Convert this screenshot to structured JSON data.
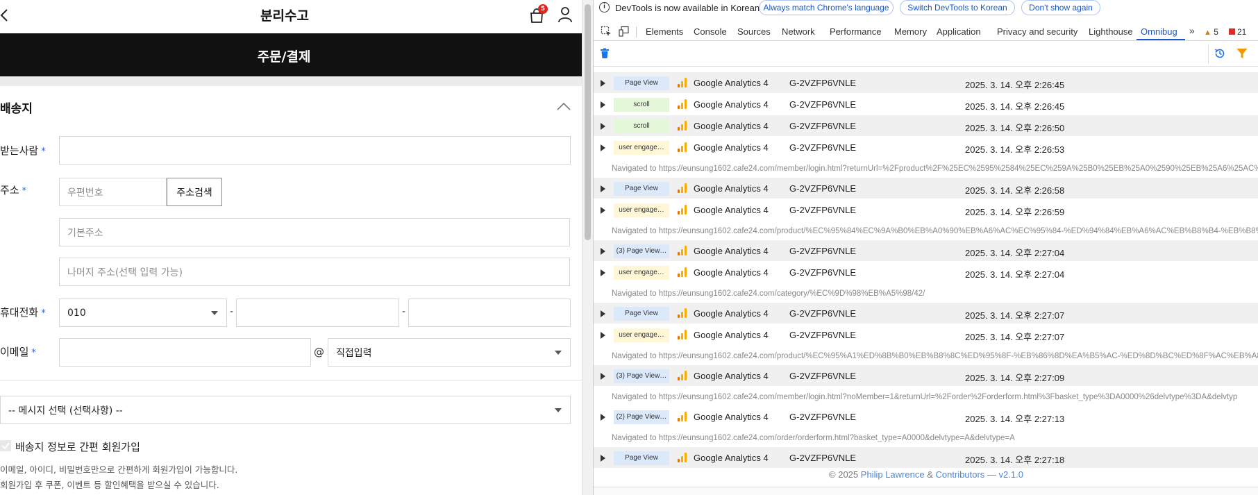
{
  "shop": {
    "brand": "분리수고",
    "cart_count": "5",
    "page_title": "주문/결제",
    "section_title": "배송지",
    "labels": {
      "recipient": "받는사람",
      "address": "주소",
      "mobile": "휴대전화",
      "email": "이메일",
      "required_mark": "*"
    },
    "fields": {
      "recipient_value": "",
      "zipcode_placeholder": "우편번호",
      "address_search_button": "주소검색",
      "base_address_placeholder": "기본주소",
      "detail_address_placeholder": "나머지 주소(선택 입력 가능)",
      "phone_prefix": "010",
      "phone_separator": "-",
      "email_at": "@",
      "email_domain_select": "직접입력",
      "message_select": "-- 메시지 선택 (선택사항) --"
    },
    "signup": {
      "checkbox_label": "배송지 정보로 간편 회원가입",
      "note1": "이메일, 아이디, 비밀번호만으로 간편하게 회원가입이 가능합니다.",
      "note2": "회원가입 후 쿠폰, 이벤트 등 할인혜택을 받으실 수 있습니다."
    }
  },
  "devtools": {
    "infobar": {
      "message": "DevTools is now available in Korean!",
      "btn_match": "Always match Chrome's language",
      "btn_switch": "Switch DevTools to Korean",
      "btn_dismiss": "Don't show again"
    },
    "tabs": [
      "Elements",
      "Console",
      "Sources",
      "Network",
      "Performance",
      "Memory",
      "Application",
      "Privacy and security",
      "Lighthouse",
      "Omnibug"
    ],
    "active_tab": "Omnibug",
    "more_tabs": "»",
    "warnings": "5",
    "errors": "21",
    "entries": [
      {
        "kind": "row",
        "tag": "Page View",
        "tag_type": "pv",
        "provider": "Google Analytics 4",
        "account": "G-2VZFP6VNLE",
        "time": "2025. 3. 14. 오후 2:26:45"
      },
      {
        "kind": "row",
        "tag": "scroll",
        "tag_type": "sc",
        "provider": "Google Analytics 4",
        "account": "G-2VZFP6VNLE",
        "time": "2025. 3. 14. 오후 2:26:45"
      },
      {
        "kind": "row",
        "tag": "scroll",
        "tag_type": "sc",
        "provider": "Google Analytics 4",
        "account": "G-2VZFP6VNLE",
        "time": "2025. 3. 14. 오후 2:26:50"
      },
      {
        "kind": "row",
        "tag": "user engage…",
        "tag_type": "ue",
        "provider": "Google Analytics 4",
        "account": "G-2VZFP6VNLE",
        "time": "2025. 3. 14. 오후 2:26:53"
      },
      {
        "kind": "nav",
        "text": "Navigated to https://eunsung1602.cafe24.com/member/login.html?returnUrl=%2Fproduct%2F%25EC%2595%2584%25EC%259A%25B0%25EB%25A0%2590%25EB%25A6%25AC%"
      },
      {
        "kind": "row",
        "tag": "Page View",
        "tag_type": "pv",
        "provider": "Google Analytics 4",
        "account": "G-2VZFP6VNLE",
        "time": "2025. 3. 14. 오후 2:26:58"
      },
      {
        "kind": "row",
        "tag": "user engage…",
        "tag_type": "ue",
        "provider": "Google Analytics 4",
        "account": "G-2VZFP6VNLE",
        "time": "2025. 3. 14. 오후 2:26:59"
      },
      {
        "kind": "nav",
        "text": "Navigated to https://eunsung1602.cafe24.com/product/%EC%95%84%EC%9A%B0%EB%A0%90%EB%A6%AC%EC%95%84-%ED%94%84%EB%A6%AC%EB%B8%B4-%EB%B8%8"
      },
      {
        "kind": "row",
        "tag": "(3) Page View…",
        "tag_type": "pv",
        "provider": "Google Analytics 4",
        "account": "G-2VZFP6VNLE",
        "time": "2025. 3. 14. 오후 2:27:04"
      },
      {
        "kind": "row",
        "tag": "user engage…",
        "tag_type": "ue",
        "provider": "Google Analytics 4",
        "account": "G-2VZFP6VNLE",
        "time": "2025. 3. 14. 오후 2:27:04"
      },
      {
        "kind": "nav",
        "text": "Navigated to https://eunsung1602.cafe24.com/category/%EC%9D%98%EB%A5%98/42/"
      },
      {
        "kind": "row",
        "tag": "Page View",
        "tag_type": "pv",
        "provider": "Google Analytics 4",
        "account": "G-2VZFP6VNLE",
        "time": "2025. 3. 14. 오후 2:27:07"
      },
      {
        "kind": "row",
        "tag": "user engage…",
        "tag_type": "ue",
        "provider": "Google Analytics 4",
        "account": "G-2VZFP6VNLE",
        "time": "2025. 3. 14. 오후 2:27:07"
      },
      {
        "kind": "nav",
        "text": "Navigated to https://eunsung1602.cafe24.com/product/%EC%95%A1%ED%8B%B0%EB%B8%8C%ED%95%8F-%EB%86%8D%EA%B5%AC-%ED%8D%BC%ED%8F%AC%EB%A8"
      },
      {
        "kind": "row",
        "tag": "(3) Page View…",
        "tag_type": "pv",
        "provider": "Google Analytics 4",
        "account": "G-2VZFP6VNLE",
        "time": "2025. 3. 14. 오후 2:27:09"
      },
      {
        "kind": "nav",
        "text": "Navigated to https://eunsung1602.cafe24.com/member/login.html?noMember=1&returnUrl=%2Forder%2Forderform.html%3Fbasket_type%3DA0000%26delvtype%3DA&delvtyp"
      },
      {
        "kind": "row",
        "tag": "(2) Page View…",
        "tag_type": "pv",
        "provider": "Google Analytics 4",
        "account": "G-2VZFP6VNLE",
        "time": "2025. 3. 14. 오후 2:27:13"
      },
      {
        "kind": "nav",
        "text": "Navigated to https://eunsung1602.cafe24.com/order/orderform.html?basket_type=A0000&delvtype=A&delvtype=A"
      },
      {
        "kind": "row",
        "tag": "Page View",
        "tag_type": "pv",
        "provider": "Google Analytics 4",
        "account": "G-2VZFP6VNLE",
        "time": "2025. 3. 14. 오후 2:27:18"
      }
    ],
    "footer": {
      "prefix": "© 2025",
      "author": "Philip Lawrence",
      "amp": "&",
      "contributors": "Contributors",
      "dash": "—",
      "version": "v2.1.0"
    },
    "colors": {
      "accent": "#1a57c9",
      "ga_orange": "#f9ab00",
      "ga_dark": "#e37400"
    }
  }
}
